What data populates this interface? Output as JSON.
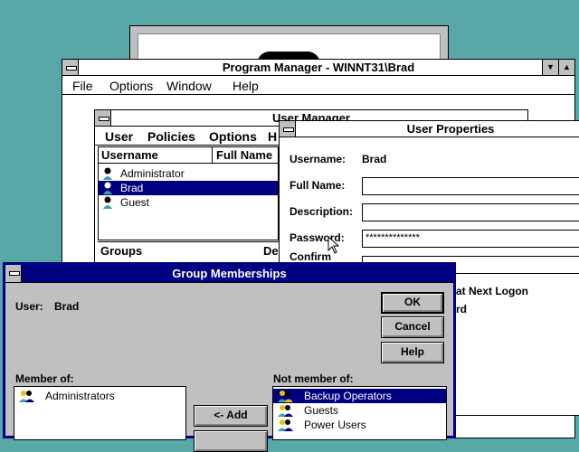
{
  "program_manager": {
    "title": "Program Manager - WINNT31\\Brad",
    "menu": [
      "File",
      "Options",
      "Window",
      "Help"
    ]
  },
  "user_manager": {
    "title": "User Manager",
    "menu": [
      "User",
      "Policies",
      "Options",
      "H"
    ],
    "columns": [
      "Username",
      "Full Name"
    ],
    "users": [
      "Administrator",
      "Brad",
      "Guest"
    ],
    "selected_user": "Brad",
    "groups_columns": [
      "Groups",
      "De"
    ]
  },
  "user_properties": {
    "title": "User Properties",
    "username_label": "Username:",
    "username_value": "Brad",
    "fullname_label": "Full Name:",
    "fullname_value": "",
    "description_label": "Description:",
    "description_value": "",
    "password_label": "Password:",
    "password_value": "**************",
    "confirm_label": "Confirm",
    "option_1": "at Next Logon",
    "option_2": "rd"
  },
  "group_memberships": {
    "title": "Group Memberships",
    "user_label": "User:",
    "user_value": "Brad",
    "ok": "OK",
    "cancel": "Cancel",
    "help": "Help",
    "member_of_label": "Member of:",
    "not_member_of_label": "Not member of:",
    "member_of": [
      "Administrators"
    ],
    "not_member_of": [
      "Backup Operators",
      "Guests",
      "Power Users"
    ],
    "add_button": "<- Add"
  },
  "colors": {
    "desktop": "#58a8a8",
    "active_title": "#000080",
    "face": "#c0c0c0"
  },
  "icons": [
    "system-menu-icon",
    "minimize-icon",
    "maximize-icon",
    "user-icon",
    "group-icon",
    "mouse-pointer-icon"
  ]
}
